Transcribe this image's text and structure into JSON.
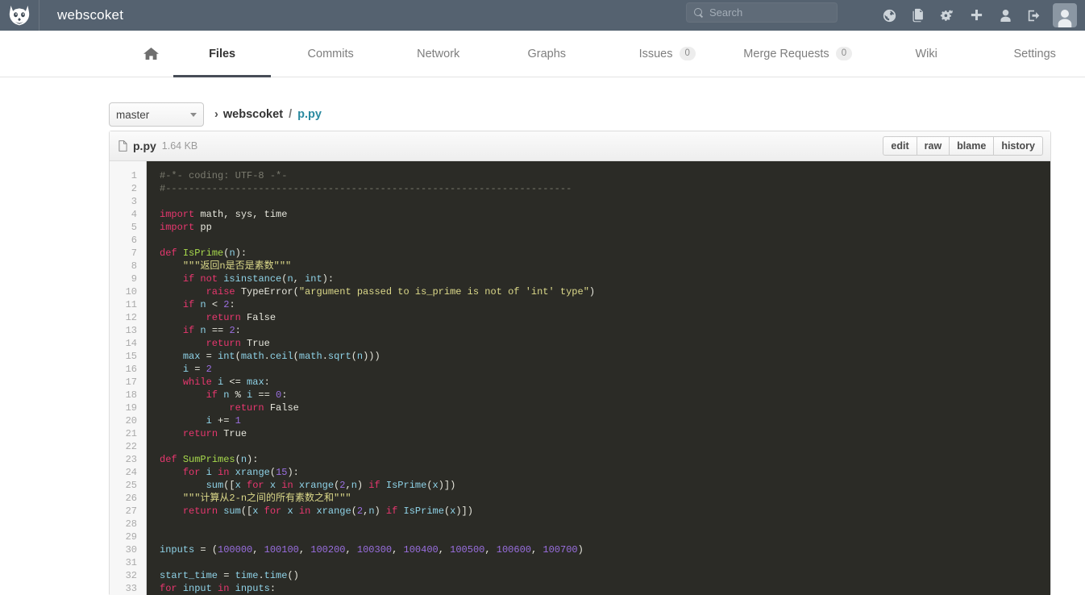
{
  "header": {
    "brand": "webscoket",
    "logo_icon": "fox-head-logo",
    "search": {
      "placeholder": "Search",
      "value": "",
      "icon": "search-icon"
    },
    "icons": [
      {
        "name": "globe-icon",
        "label": "Public Area"
      },
      {
        "name": "files-icon",
        "label": "Snippets"
      },
      {
        "name": "gears-icon",
        "label": "Admin Area"
      },
      {
        "name": "plus-icon",
        "label": "New Project"
      },
      {
        "name": "user-icon",
        "label": "Profile Settings"
      },
      {
        "name": "signout-icon",
        "label": "Logout"
      }
    ],
    "avatar_icon": "user-avatar"
  },
  "nav": {
    "home_icon": "home-icon",
    "items": [
      {
        "label": "Files",
        "active": true,
        "badge": null
      },
      {
        "label": "Commits",
        "active": false,
        "badge": null
      },
      {
        "label": "Network",
        "active": false,
        "badge": null
      },
      {
        "label": "Graphs",
        "active": false,
        "badge": null
      },
      {
        "label": "Issues",
        "active": false,
        "badge": "0"
      },
      {
        "label": "Merge Requests",
        "active": false,
        "badge": "0"
      },
      {
        "label": "Wiki",
        "active": false,
        "badge": null
      },
      {
        "label": "Settings",
        "active": false,
        "badge": null
      }
    ]
  },
  "breadcrumb": {
    "branch": "master",
    "separator": "›",
    "repo": "webscoket",
    "slash": "/",
    "file": "p.py"
  },
  "file_panel": {
    "icon": "file-icon",
    "name": "p.py",
    "size": "1.64 KB",
    "actions": [
      "edit",
      "raw",
      "blame",
      "history"
    ]
  },
  "code": {
    "language": "python",
    "first_line": 1,
    "last_line": 33,
    "lines": [
      {
        "n": 1,
        "tokens": [
          [
            "c",
            "#-*- coding: UTF-8 -*-"
          ]
        ]
      },
      {
        "n": 2,
        "tokens": [
          [
            "c",
            "#----------------------------------------------------------------------"
          ]
        ]
      },
      {
        "n": 3,
        "tokens": []
      },
      {
        "n": 4,
        "tokens": [
          [
            "kf",
            "import"
          ],
          [
            "p",
            " math, sys, time"
          ]
        ]
      },
      {
        "n": 5,
        "tokens": [
          [
            "kf",
            "import"
          ],
          [
            "p",
            " pp"
          ]
        ]
      },
      {
        "n": 6,
        "tokens": []
      },
      {
        "n": 7,
        "tokens": [
          [
            "kf",
            "def"
          ],
          [
            "p",
            " "
          ],
          [
            "fn",
            "IsPrime"
          ],
          [
            "p",
            "("
          ],
          [
            "nm",
            "n"
          ],
          [
            "p",
            "):"
          ]
        ]
      },
      {
        "n": 8,
        "tokens": [
          [
            "p",
            "    "
          ],
          [
            "s",
            "\"\"\"返回n是否是素数\"\"\""
          ]
        ]
      },
      {
        "n": 9,
        "tokens": [
          [
            "p",
            "    "
          ],
          [
            "k",
            "if"
          ],
          [
            "p",
            " "
          ],
          [
            "k",
            "not"
          ],
          [
            "p",
            " "
          ],
          [
            "bi",
            "isinstance"
          ],
          [
            "p",
            "("
          ],
          [
            "nm",
            "n"
          ],
          [
            "p",
            ", "
          ],
          [
            "bi",
            "int"
          ],
          [
            "p",
            "):"
          ]
        ]
      },
      {
        "n": 10,
        "tokens": [
          [
            "p",
            "        "
          ],
          [
            "k",
            "raise"
          ],
          [
            "p",
            " TypeError("
          ],
          [
            "s",
            "\"argument passed to is_prime is not of 'int' type\""
          ],
          [
            "p",
            ")"
          ]
        ]
      },
      {
        "n": 11,
        "tokens": [
          [
            "p",
            "    "
          ],
          [
            "k",
            "if"
          ],
          [
            "p",
            " "
          ],
          [
            "nm",
            "n"
          ],
          [
            "p",
            " < "
          ],
          [
            "n",
            "2"
          ],
          [
            "p",
            ":"
          ]
        ]
      },
      {
        "n": 12,
        "tokens": [
          [
            "p",
            "        "
          ],
          [
            "k",
            "return"
          ],
          [
            "p",
            " False"
          ]
        ]
      },
      {
        "n": 13,
        "tokens": [
          [
            "p",
            "    "
          ],
          [
            "k",
            "if"
          ],
          [
            "p",
            " "
          ],
          [
            "nm",
            "n"
          ],
          [
            "p",
            " == "
          ],
          [
            "n",
            "2"
          ],
          [
            "p",
            ":"
          ]
        ]
      },
      {
        "n": 14,
        "tokens": [
          [
            "p",
            "        "
          ],
          [
            "k",
            "return"
          ],
          [
            "p",
            " True"
          ]
        ]
      },
      {
        "n": 15,
        "tokens": [
          [
            "p",
            "    "
          ],
          [
            "nm",
            "max"
          ],
          [
            "p",
            " = "
          ],
          [
            "bi",
            "int"
          ],
          [
            "p",
            "("
          ],
          [
            "nm",
            "math"
          ],
          [
            "p",
            "."
          ],
          [
            "bi",
            "ceil"
          ],
          [
            "p",
            "("
          ],
          [
            "nm",
            "math"
          ],
          [
            "p",
            "."
          ],
          [
            "bi",
            "sqrt"
          ],
          [
            "p",
            "("
          ],
          [
            "nm",
            "n"
          ],
          [
            "p",
            ")))"
          ]
        ]
      },
      {
        "n": 16,
        "tokens": [
          [
            "p",
            "    "
          ],
          [
            "nm",
            "i"
          ],
          [
            "p",
            " = "
          ],
          [
            "n",
            "2"
          ]
        ]
      },
      {
        "n": 17,
        "tokens": [
          [
            "p",
            "    "
          ],
          [
            "k",
            "while"
          ],
          [
            "p",
            " "
          ],
          [
            "nm",
            "i"
          ],
          [
            "p",
            " <= "
          ],
          [
            "nm",
            "max"
          ],
          [
            "p",
            ":"
          ]
        ]
      },
      {
        "n": 18,
        "tokens": [
          [
            "p",
            "        "
          ],
          [
            "k",
            "if"
          ],
          [
            "p",
            " "
          ],
          [
            "nm",
            "n"
          ],
          [
            "p",
            " % "
          ],
          [
            "nm",
            "i"
          ],
          [
            "p",
            " == "
          ],
          [
            "n",
            "0"
          ],
          [
            "p",
            ":"
          ]
        ]
      },
      {
        "n": 19,
        "tokens": [
          [
            "p",
            "            "
          ],
          [
            "k",
            "return"
          ],
          [
            "p",
            " False"
          ]
        ]
      },
      {
        "n": 20,
        "tokens": [
          [
            "p",
            "        "
          ],
          [
            "nm",
            "i"
          ],
          [
            "p",
            " += "
          ],
          [
            "n",
            "1"
          ]
        ]
      },
      {
        "n": 21,
        "tokens": [
          [
            "p",
            "    "
          ],
          [
            "k",
            "return"
          ],
          [
            "p",
            " True"
          ]
        ]
      },
      {
        "n": 22,
        "tokens": []
      },
      {
        "n": 23,
        "tokens": [
          [
            "kf",
            "def"
          ],
          [
            "p",
            " "
          ],
          [
            "fn",
            "SumPrimes"
          ],
          [
            "p",
            "("
          ],
          [
            "nm",
            "n"
          ],
          [
            "p",
            "):"
          ]
        ]
      },
      {
        "n": 24,
        "tokens": [
          [
            "p",
            "    "
          ],
          [
            "k",
            "for"
          ],
          [
            "p",
            " "
          ],
          [
            "nm",
            "i"
          ],
          [
            "p",
            " "
          ],
          [
            "k",
            "in"
          ],
          [
            "p",
            " "
          ],
          [
            "bi",
            "xrange"
          ],
          [
            "p",
            "("
          ],
          [
            "n",
            "15"
          ],
          [
            "p",
            "):"
          ]
        ]
      },
      {
        "n": 25,
        "tokens": [
          [
            "p",
            "        "
          ],
          [
            "bi",
            "sum"
          ],
          [
            "p",
            "(["
          ],
          [
            "nm",
            "x"
          ],
          [
            "p",
            " "
          ],
          [
            "k",
            "for"
          ],
          [
            "p",
            " "
          ],
          [
            "nm",
            "x"
          ],
          [
            "p",
            " "
          ],
          [
            "k",
            "in"
          ],
          [
            "p",
            " "
          ],
          [
            "bi",
            "xrange"
          ],
          [
            "p",
            "("
          ],
          [
            "n",
            "2"
          ],
          [
            "p",
            ","
          ],
          [
            "nm",
            "n"
          ],
          [
            "p",
            ") "
          ],
          [
            "k",
            "if"
          ],
          [
            "p",
            " "
          ],
          [
            "bi",
            "IsPrime"
          ],
          [
            "p",
            "("
          ],
          [
            "nm",
            "x"
          ],
          [
            "p",
            ")])"
          ]
        ]
      },
      {
        "n": 26,
        "tokens": [
          [
            "p",
            "    "
          ],
          [
            "s",
            "\"\"\"计算从2-n之间的所有素数之和\"\"\""
          ]
        ]
      },
      {
        "n": 27,
        "tokens": [
          [
            "p",
            "    "
          ],
          [
            "k",
            "return"
          ],
          [
            "p",
            " "
          ],
          [
            "bi",
            "sum"
          ],
          [
            "p",
            "(["
          ],
          [
            "nm",
            "x"
          ],
          [
            "p",
            " "
          ],
          [
            "k",
            "for"
          ],
          [
            "p",
            " "
          ],
          [
            "nm",
            "x"
          ],
          [
            "p",
            " "
          ],
          [
            "k",
            "in"
          ],
          [
            "p",
            " "
          ],
          [
            "bi",
            "xrange"
          ],
          [
            "p",
            "("
          ],
          [
            "n",
            "2"
          ],
          [
            "p",
            ","
          ],
          [
            "nm",
            "n"
          ],
          [
            "p",
            ") "
          ],
          [
            "k",
            "if"
          ],
          [
            "p",
            " "
          ],
          [
            "bi",
            "IsPrime"
          ],
          [
            "p",
            "("
          ],
          [
            "nm",
            "x"
          ],
          [
            "p",
            ")])"
          ]
        ]
      },
      {
        "n": 28,
        "tokens": []
      },
      {
        "n": 29,
        "tokens": []
      },
      {
        "n": 30,
        "tokens": [
          [
            "nm",
            "inputs"
          ],
          [
            "p",
            " = ("
          ],
          [
            "n",
            "100000"
          ],
          [
            "p",
            ", "
          ],
          [
            "n",
            "100100"
          ],
          [
            "p",
            ", "
          ],
          [
            "n",
            "100200"
          ],
          [
            "p",
            ", "
          ],
          [
            "n",
            "100300"
          ],
          [
            "p",
            ", "
          ],
          [
            "n",
            "100400"
          ],
          [
            "p",
            ", "
          ],
          [
            "n",
            "100500"
          ],
          [
            "p",
            ", "
          ],
          [
            "n",
            "100600"
          ],
          [
            "p",
            ", "
          ],
          [
            "n",
            "100700"
          ],
          [
            "p",
            ")"
          ]
        ]
      },
      {
        "n": 31,
        "tokens": []
      },
      {
        "n": 32,
        "tokens": [
          [
            "nm",
            "start_time"
          ],
          [
            "p",
            " = "
          ],
          [
            "nm",
            "time"
          ],
          [
            "p",
            "."
          ],
          [
            "bi",
            "time"
          ],
          [
            "p",
            "()"
          ]
        ]
      },
      {
        "n": 33,
        "tokens": [
          [
            "k",
            "for"
          ],
          [
            "p",
            " "
          ],
          [
            "nm",
            "input"
          ],
          [
            "p",
            " "
          ],
          [
            "k",
            "in"
          ],
          [
            "p",
            " "
          ],
          [
            "nm",
            "inputs"
          ],
          [
            "p",
            ":"
          ]
        ]
      }
    ]
  },
  "colors": {
    "header_bg": "#556270",
    "code_bg": "#2b2b26",
    "gutter_bg": "#f7f7f7",
    "accent_link": "#2b8aa0",
    "active_tab_underline": "#474d57"
  }
}
